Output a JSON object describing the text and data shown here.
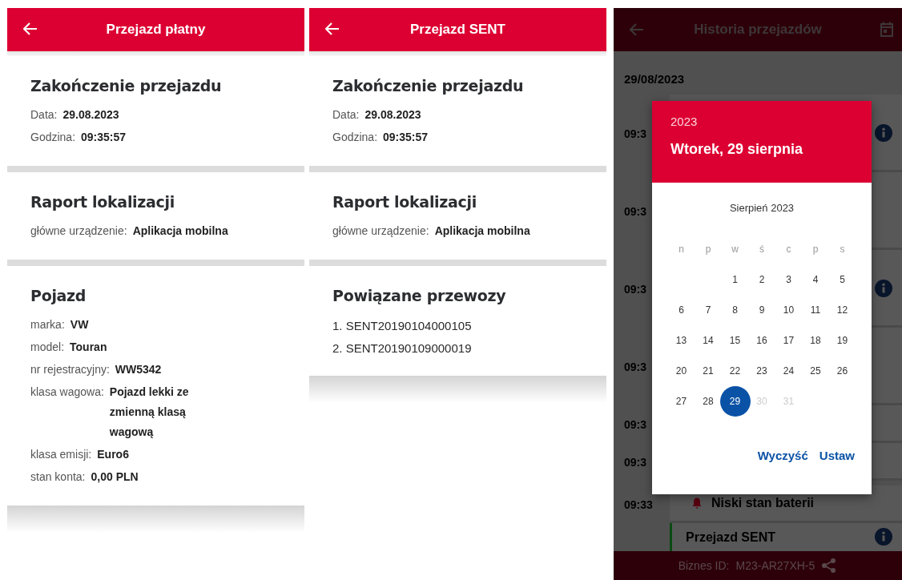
{
  "screens": [
    {
      "title": "Przejazd płatny",
      "sections": [
        {
          "kind": "fields",
          "title": "Zakończenie przejazdu",
          "rows": [
            {
              "label": "Data:",
              "value": "29.08.2023"
            },
            {
              "label": "Godzina:",
              "value": "09:35:57"
            }
          ]
        },
        {
          "kind": "fields",
          "title": "Raport lokalizacji",
          "rows": [
            {
              "label": "główne urządzenie:",
              "value": "Aplikacja mobilna"
            }
          ]
        },
        {
          "kind": "fields",
          "title": "Pojazd",
          "rows": [
            {
              "label": "marka:",
              "value": "VW"
            },
            {
              "label": "model:",
              "value": "Touran"
            },
            {
              "label": "nr rejestracyjny:",
              "value": "WW5342"
            },
            {
              "label": "klasa wagowa:",
              "value": "Pojazd lekki ze zmienną klasą wagową"
            },
            {
              "label": "klasa emisji:",
              "value": "Euro6"
            },
            {
              "label": "stan konta:",
              "value": "0,00 PLN"
            }
          ]
        }
      ]
    },
    {
      "title": "Przejazd SENT",
      "sections": [
        {
          "kind": "fields",
          "title": "Zakończenie przejazdu",
          "rows": [
            {
              "label": "Data:",
              "value": "29.08.2023"
            },
            {
              "label": "Godzina:",
              "value": "09:35:57"
            }
          ]
        },
        {
          "kind": "fields",
          "title": "Raport lokalizacji",
          "rows": [
            {
              "label": "główne urządzenie:",
              "value": "Aplikacja mobilna"
            }
          ]
        },
        {
          "kind": "list",
          "title": "Powiązane przewozy",
          "items": [
            "1. SENT20190104000105",
            "2. SENT20190109000019"
          ]
        }
      ]
    }
  ],
  "history": {
    "title": "Historia przejazdów",
    "date": "29/08/2023",
    "entries": [
      {
        "kind": "info",
        "time": "09:3"
      },
      {
        "kind": "plain",
        "time": "09:3"
      },
      {
        "kind": "info",
        "time": "09:3"
      },
      {
        "kind": "plain",
        "time": "09:3"
      },
      {
        "kind": "short",
        "time": "09:3"
      },
      {
        "kind": "short",
        "time": "09:3"
      },
      {
        "kind": "alert",
        "time": "09:33",
        "title": "Niski stan baterii"
      },
      {
        "kind": "trip",
        "title": "Przejazd SENT"
      }
    ],
    "footer": {
      "label": "Biznes ID:",
      "value": "M23-AR27XH-5"
    },
    "date_picker": {
      "year": "2023",
      "selected_date": "Wtorek, 29 sierpnia",
      "month": "Sierpień 2023",
      "weekdays": [
        "n",
        "p",
        "w",
        "ś",
        "c",
        "p",
        "s"
      ],
      "weeks": [
        {
          "kind": "first",
          "days": [
            {
              "label": "1",
              "selected": false,
              "disabled": false
            },
            {
              "label": "2",
              "selected": false,
              "disabled": false
            },
            {
              "label": "3",
              "selected": false,
              "disabled": false
            },
            {
              "label": "4",
              "selected": false,
              "disabled": false
            },
            {
              "label": "5",
              "selected": false,
              "disabled": false
            }
          ]
        },
        {
          "kind": "full",
          "days": [
            {
              "label": "6",
              "selected": false,
              "disabled": false
            },
            {
              "label": "7",
              "selected": false,
              "disabled": false
            },
            {
              "label": "8",
              "selected": false,
              "disabled": false
            },
            {
              "label": "9",
              "selected": false,
              "disabled": false
            },
            {
              "label": "10",
              "selected": false,
              "disabled": false
            },
            {
              "label": "11",
              "selected": false,
              "disabled": false
            },
            {
              "label": "12",
              "selected": false,
              "disabled": false
            }
          ]
        },
        {
          "kind": "full",
          "days": [
            {
              "label": "13",
              "selected": false,
              "disabled": false
            },
            {
              "label": "14",
              "selected": false,
              "disabled": false
            },
            {
              "label": "15",
              "selected": false,
              "disabled": false
            },
            {
              "label": "16",
              "selected": false,
              "disabled": false
            },
            {
              "label": "17",
              "selected": false,
              "disabled": false
            },
            {
              "label": "18",
              "selected": false,
              "disabled": false
            },
            {
              "label": "19",
              "selected": false,
              "disabled": false
            }
          ]
        },
        {
          "kind": "full",
          "days": [
            {
              "label": "20",
              "selected": false,
              "disabled": false
            },
            {
              "label": "21",
              "selected": false,
              "disabled": false
            },
            {
              "label": "22",
              "selected": false,
              "disabled": false
            },
            {
              "label": "23",
              "selected": false,
              "disabled": false
            },
            {
              "label": "24",
              "selected": false,
              "disabled": false
            },
            {
              "label": "25",
              "selected": false,
              "disabled": false
            },
            {
              "label": "26",
              "selected": false,
              "disabled": false
            }
          ]
        },
        {
          "kind": "last",
          "days": [
            {
              "label": "27",
              "selected": false,
              "disabled": false
            },
            {
              "label": "28",
              "selected": false,
              "disabled": false
            },
            {
              "label": "29",
              "selected": true,
              "disabled": false
            },
            {
              "label": "30",
              "selected": false,
              "disabled": true
            },
            {
              "label": "31",
              "selected": false,
              "disabled": true
            }
          ]
        }
      ],
      "actions": [
        "Wyczyść",
        "Ustaw"
      ]
    }
  }
}
